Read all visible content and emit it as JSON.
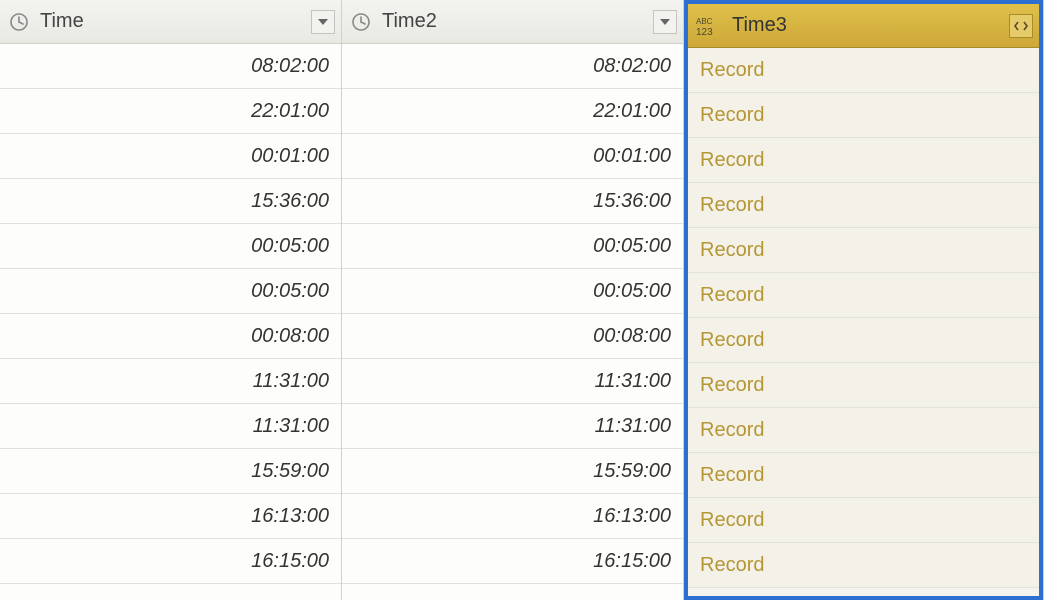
{
  "columns": {
    "time": {
      "label": "Time",
      "type": "time"
    },
    "time2": {
      "label": "Time2",
      "type": "time"
    },
    "time3": {
      "label": "Time3",
      "type": "any"
    }
  },
  "rows": [
    {
      "time": "08:02:00",
      "time2": "08:02:00",
      "time3": "Record"
    },
    {
      "time": "22:01:00",
      "time2": "22:01:00",
      "time3": "Record"
    },
    {
      "time": "00:01:00",
      "time2": "00:01:00",
      "time3": "Record"
    },
    {
      "time": "15:36:00",
      "time2": "15:36:00",
      "time3": "Record"
    },
    {
      "time": "00:05:00",
      "time2": "00:05:00",
      "time3": "Record"
    },
    {
      "time": "00:05:00",
      "time2": "00:05:00",
      "time3": "Record"
    },
    {
      "time": "00:08:00",
      "time2": "00:08:00",
      "time3": "Record"
    },
    {
      "time": "11:31:00",
      "time2": "11:31:00",
      "time3": "Record"
    },
    {
      "time": "11:31:00",
      "time2": "11:31:00",
      "time3": "Record"
    },
    {
      "time": "15:59:00",
      "time2": "15:59:00",
      "time3": "Record"
    },
    {
      "time": "16:13:00",
      "time2": "16:13:00",
      "time3": "Record"
    },
    {
      "time": "16:15:00",
      "time2": "16:15:00",
      "time3": "Record"
    }
  ]
}
